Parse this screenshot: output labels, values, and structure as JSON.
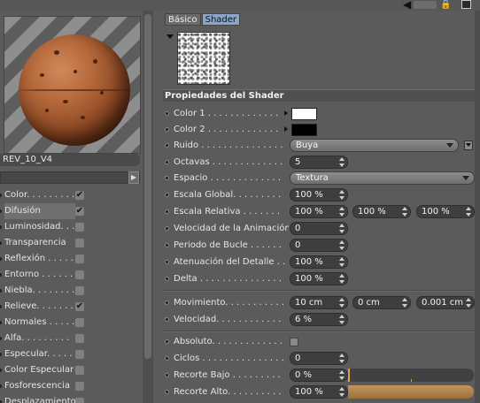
{
  "material": {
    "name": "REV_10_V4"
  },
  "channels": [
    {
      "label": "Color. . . . . . . . .",
      "checked": "✔",
      "selected": false
    },
    {
      "label": "Difusión",
      "checked": "✔",
      "selected": true
    },
    {
      "label": "Luminosidad. . .",
      "checked": "",
      "selected": false
    },
    {
      "label": "Transparencia",
      "checked": "",
      "selected": false
    },
    {
      "label": "Reflexión . . . . . .",
      "checked": "",
      "selected": false
    },
    {
      "label": "Entorno . . . . . . .",
      "checked": "",
      "selected": false
    },
    {
      "label": "Niebla. . . . . . . .",
      "checked": "",
      "selected": false
    },
    {
      "label": "Relieve. . . . . . .",
      "checked": "✔",
      "selected": false
    },
    {
      "label": "Normales . . . . .",
      "checked": "",
      "selected": false
    },
    {
      "label": "Alfa. . . . . . . . .",
      "checked": "",
      "selected": false
    },
    {
      "label": "Especular. . . . .",
      "checked": "",
      "selected": false
    },
    {
      "label": "Color Especular",
      "checked": "",
      "selected": false
    },
    {
      "label": "Fosforescencia",
      "checked": "",
      "selected": false
    },
    {
      "label": "Desplazamiento",
      "checked": "",
      "selected": false
    }
  ],
  "tabs": [
    {
      "label": "Básico",
      "active": false
    },
    {
      "label": "Shader",
      "active": true
    }
  ],
  "section_title": "Propiedades del Shader",
  "params": {
    "color1": {
      "label": "Color 1 . . . . . . . . . . . . .",
      "color": "#ffffff"
    },
    "color2": {
      "label": "Color 2 . . . . . . . . . . . . .",
      "color": "#000000"
    },
    "ruido": {
      "label": "Ruido . . . . . . . . . . . . . . .",
      "value": "Buya"
    },
    "octavas": {
      "label": "Octavas . . . . . . . . . . . . .",
      "value": "5"
    },
    "espacio": {
      "label": "Espacio . . . . . . . . . . . . .",
      "value": "Textura"
    },
    "escala_global": {
      "label": "Escala Global. . . . . . . . .",
      "value": "100 %"
    },
    "escala_relativa": {
      "label": "Escala Relativa . . . . . . .",
      "values": [
        "100 %",
        "100 %",
        "100 %"
      ]
    },
    "velocidad_anim": {
      "label": "Velocidad de la Animación",
      "value": "0"
    },
    "periodo_bucle": {
      "label": "Periodo de Bucle . . . . . .",
      "value": "0"
    },
    "atenuacion": {
      "label": "Atenuación del Detalle . . .",
      "value": "100 %"
    },
    "delta": {
      "label": "Delta . . . . . . . . . . . . . . .",
      "value": "100 %"
    },
    "movimiento": {
      "label": "Movimiento. . . . . . . . . . .",
      "values": [
        "10 cm",
        "0 cm",
        "0.001 cm"
      ]
    },
    "velocidad": {
      "label": "Velocidad. . . . . . . . . . . .",
      "value": "6 %"
    },
    "absoluto": {
      "label": "Absoluto. . . . . . . . . . . . .",
      "checked": false
    },
    "ciclos": {
      "label": "Ciclos . . . . . . . . . . . . . . .",
      "value": "0"
    },
    "recorte_bajo": {
      "label": "Recorte Bajo . . . . . . . . .",
      "value": "0 %",
      "level": 0.0
    },
    "recorte_alto": {
      "label": "Recorte Alto. . . . . . . . . .",
      "value": "100 %",
      "level": 1.0
    }
  },
  "colors": {
    "tab_active": "#8aa5c8",
    "slider_fill": "#c6955a",
    "sphere": "#b66a3c"
  },
  "icons": [
    "arrow-left-icon",
    "lock-icon",
    "grid-icon",
    "checkmark-icon",
    "spinner-icon",
    "dropdown-arrow-icon"
  ]
}
